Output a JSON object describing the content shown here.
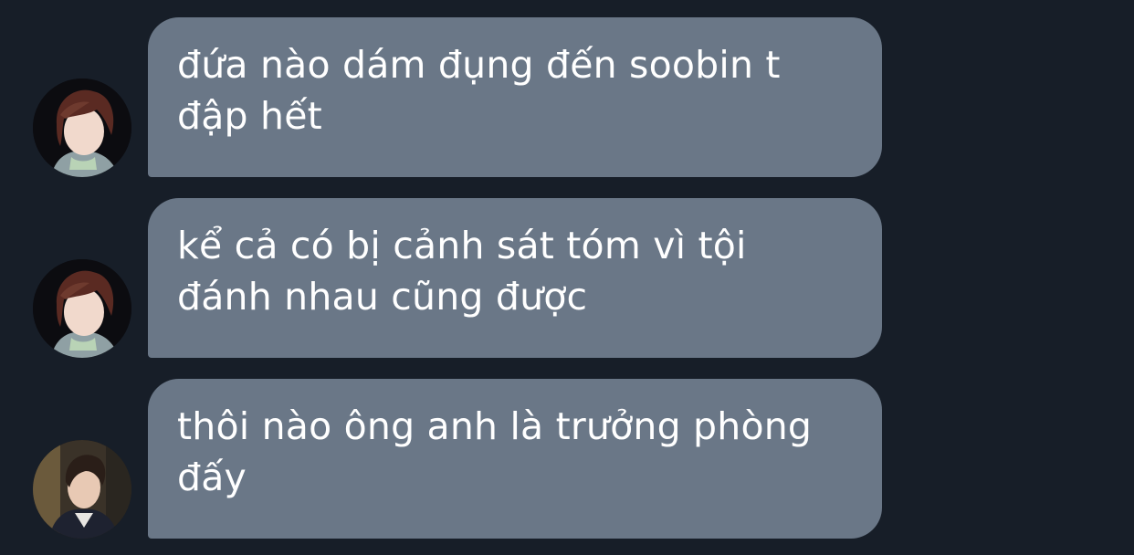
{
  "messages": [
    {
      "avatar_icon": "person-avatar-icon",
      "text": "đứa nào dám đụng đến soobin t đập hết"
    },
    {
      "avatar_icon": "person-avatar-icon",
      "text": "kể cả có bị cảnh sát tóm vì tội đánh nhau cũng được"
    },
    {
      "avatar_icon": "person-avatar-icon",
      "text": "thôi nào ông anh là trưởng phòng đấy"
    }
  ],
  "colors": {
    "background": "#171e28",
    "bubble": "#6a7787",
    "text": "#ffffff"
  }
}
